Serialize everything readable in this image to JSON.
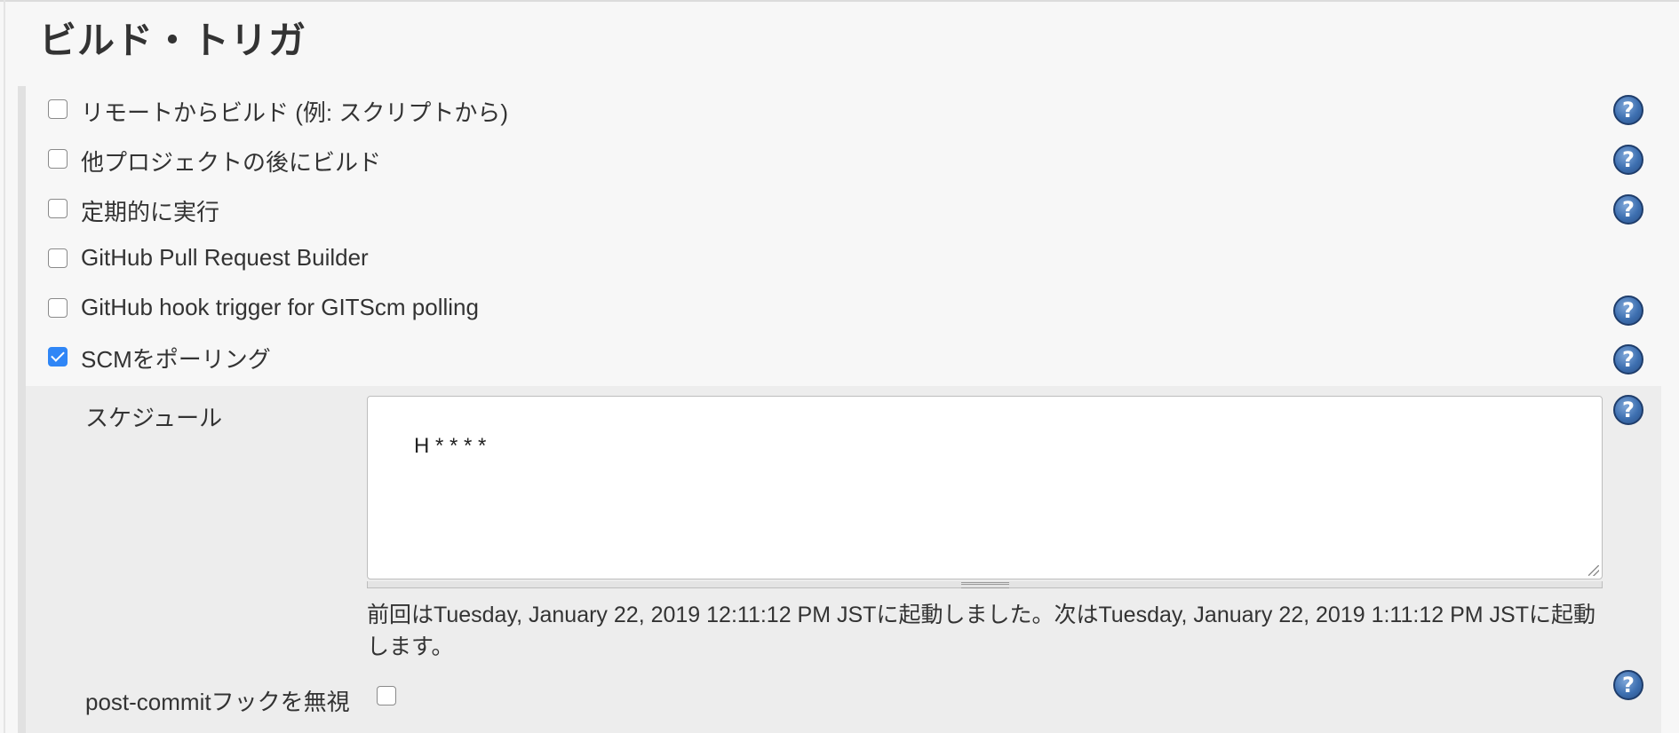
{
  "section": {
    "title": "ビルド・トリガ"
  },
  "triggers": [
    {
      "label": "リモートからビルド (例: スクリプトから)",
      "checked": false,
      "help": true
    },
    {
      "label": "他プロジェクトの後にビルド",
      "checked": false,
      "help": true
    },
    {
      "label": "定期的に実行",
      "checked": false,
      "help": true
    },
    {
      "label": "GitHub Pull Request Builder",
      "checked": false,
      "help": false
    },
    {
      "label": "GitHub hook trigger for GITScm polling",
      "checked": false,
      "help": true
    },
    {
      "label": "SCMをポーリング",
      "checked": true,
      "help": true
    }
  ],
  "scm_poll": {
    "schedule_label": "スケジュール",
    "schedule_value": "H * * * *",
    "info_text": "前回はTuesday, January 22, 2019 12:11:12 PM JSTに起動しました。次はTuesday, January 22, 2019 1:11:12 PM JSTに起動します。",
    "post_commit_label": "post-commitフックを無視",
    "post_commit_checked": false
  },
  "help_glyph": "?",
  "icons": {
    "help": "help-icon",
    "checkbox": "checkbox"
  },
  "colors": {
    "checked": "#2f86f6",
    "help": "#3d6fb0",
    "panel": "#ededed"
  }
}
